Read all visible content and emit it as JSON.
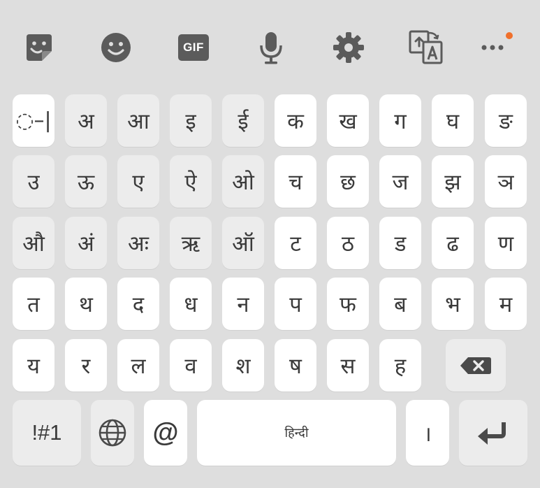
{
  "toolbar": {
    "icons": [
      "sticker-icon",
      "emoji-icon",
      "gif-icon",
      "mic-icon",
      "settings-icon",
      "translate-icon",
      "more-icon"
    ],
    "gif_label": "GIF",
    "badge_color": "#f0702b"
  },
  "keys": {
    "row1": [
      "◌–|",
      "अ",
      "आ",
      "इ",
      "ई",
      "क",
      "ख",
      "ग",
      "घ",
      "ङ"
    ],
    "row2": [
      "उ",
      "ऊ",
      "ए",
      "ऐ",
      "ओ",
      "च",
      "छ",
      "ज",
      "झ",
      "ञ"
    ],
    "row3": [
      "औ",
      "अं",
      "अः",
      "ऋ",
      "ऑ",
      "ट",
      "ठ",
      "ड",
      "ढ",
      "ण"
    ],
    "row4": [
      "त",
      "थ",
      "द",
      "ध",
      "न",
      "प",
      "फ",
      "ब",
      "भ",
      "म"
    ],
    "row5": [
      "य",
      "र",
      "ल",
      "व",
      "श",
      "ष",
      "स",
      "ह"
    ]
  },
  "bottom": {
    "symbols_label": "!#1",
    "at_label": "@",
    "space_label": "हिन्दी",
    "danda_label": "।"
  },
  "colors": {
    "background": "#dedede",
    "key": "#f7f7f7",
    "vowel_key": "#ececec",
    "icon": "#5b5b5b"
  }
}
